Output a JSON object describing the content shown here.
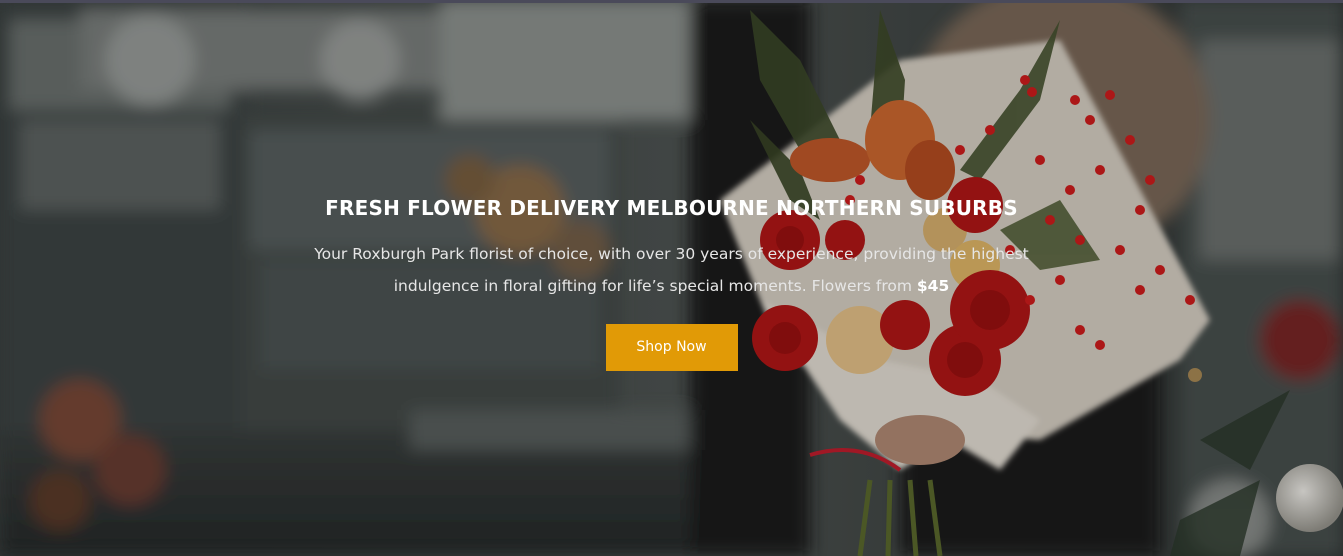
{
  "hero": {
    "title": "FRESH FLOWER DELIVERY MELBOURNE NORTHERN SUBURBS",
    "description": "Your Roxburgh Park florist of choice, with over 30 years of experience, providing the highest indulgence in floral gifting for life’s special moments. Flowers from",
    "price": "$45",
    "cta_label": "Shop Now"
  },
  "colors": {
    "accent": "#e19a06",
    "overlay": "#000000",
    "text": "#ffffff"
  }
}
